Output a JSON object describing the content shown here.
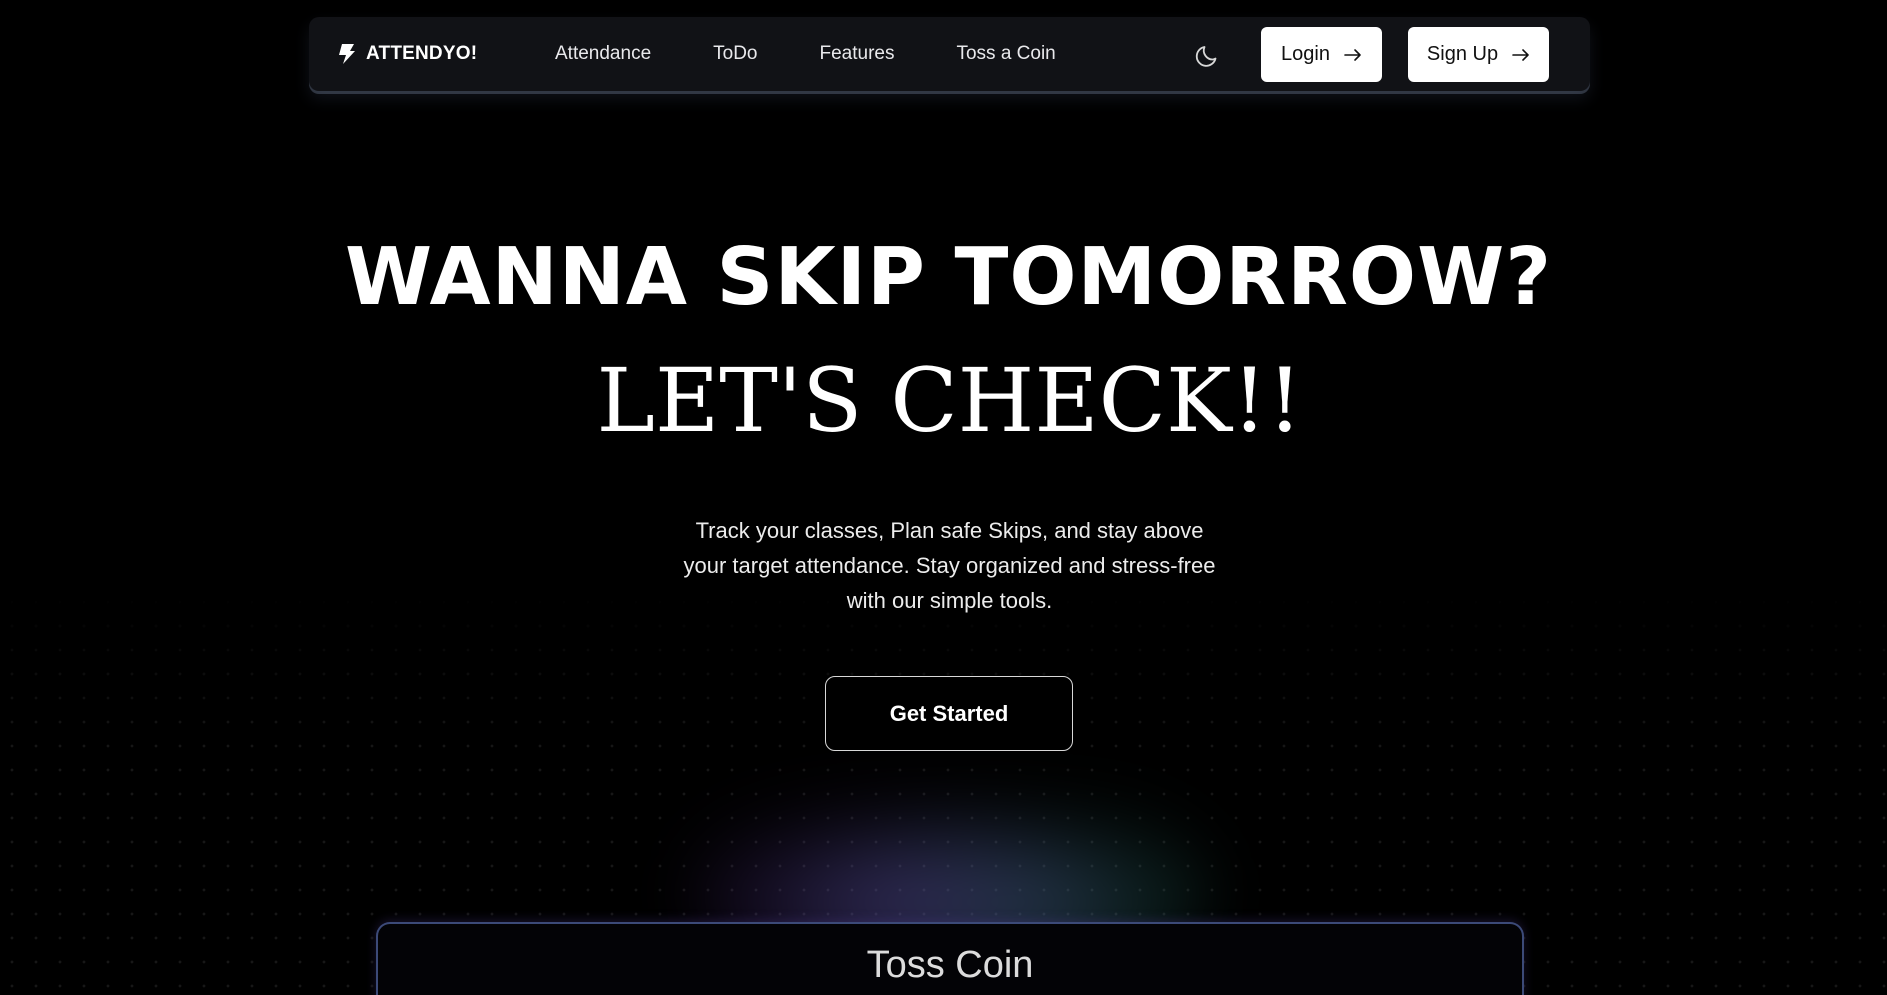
{
  "nav": {
    "brand": "ATTENDYO!",
    "brand_icon": "bolt-icon",
    "links": [
      "Attendance",
      "ToDo",
      "Features",
      "Toss a Coin"
    ],
    "theme_icon": "moon-icon",
    "login_label": "Login",
    "signup_label": "Sign Up",
    "button_icon": "arrow-right-icon"
  },
  "hero": {
    "line1": "WANNA SKIP TOMORROW?",
    "line2": "LET'S CHECK!!",
    "subtitle_lines": [
      "Track your classes, Plan safe Skips, and stay above",
      "your target attendance. Stay organized and stress-free",
      "with our simple tools."
    ],
    "cta_label": "Get Started"
  },
  "card": {
    "title": "Toss Coin"
  },
  "colors": {
    "background": "#000000",
    "navbar": "#111216",
    "button_bg": "#ffffff",
    "card_border": "#3c4a78"
  }
}
